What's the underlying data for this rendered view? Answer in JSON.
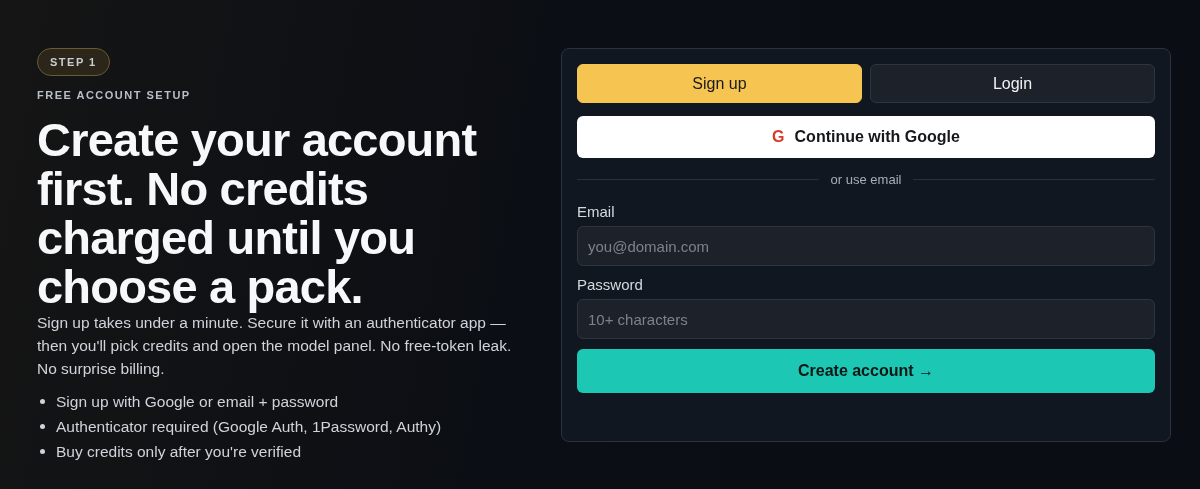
{
  "intro": {
    "badge": "STEP 1",
    "eyebrow": "FREE ACCOUNT SETUP",
    "headline": "Create your account first. No credits charged until you choose a pack.",
    "description": "Sign up takes under a minute. Secure it with an authenticator app — then you'll pick credits and open the model panel. No free-token leak. No surprise billing.",
    "bullets": [
      "Sign up with Google or email + password",
      "Authenticator required (Google Auth, 1Password, Authy)",
      "Buy credits only after you're verified"
    ]
  },
  "auth_card": {
    "tabs": [
      {
        "label": "Sign up",
        "selected": true
      },
      {
        "label": "Login",
        "selected": false
      }
    ],
    "google_button": {
      "icon": "G",
      "label": "Continue with Google"
    },
    "divider": "or use email",
    "fields": [
      {
        "label": "Email",
        "placeholder": "you@domain.com"
      },
      {
        "label": "Password",
        "placeholder": "10+ characters"
      }
    ],
    "submit": "Create account →"
  }
}
